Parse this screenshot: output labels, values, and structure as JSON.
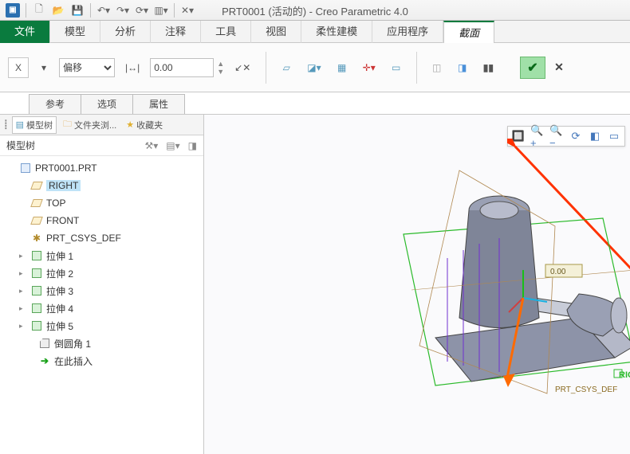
{
  "title": "PRT0001 (活动的) - Creo Parametric 4.0",
  "ribbon": {
    "tabs": [
      "文件",
      "模型",
      "分析",
      "注释",
      "工具",
      "视图",
      "柔性建模",
      "应用程序",
      "截面"
    ],
    "offset_label": "偏移",
    "offset_value": "0.00",
    "subtabs": [
      "参考",
      "选项",
      "属性"
    ]
  },
  "sidebar": {
    "tabs": {
      "model_tree": "模型树",
      "folder": "文件夹浏...",
      "fav": "收藏夹"
    },
    "heading": "模型树",
    "root": "PRT0001.PRT",
    "planes": [
      "RIGHT",
      "TOP",
      "FRONT"
    ],
    "csys": "PRT_CSYS_DEF",
    "features": [
      "拉伸 1",
      "拉伸 2",
      "拉伸 3",
      "拉伸 4",
      "拉伸 5"
    ],
    "chamfer": "倒圆角 1",
    "insert": "在此插入"
  },
  "viewport": {
    "dim": "0.00",
    "csys_label": "PRT_CSYS_DEF",
    "right_label": "RIGHT"
  }
}
